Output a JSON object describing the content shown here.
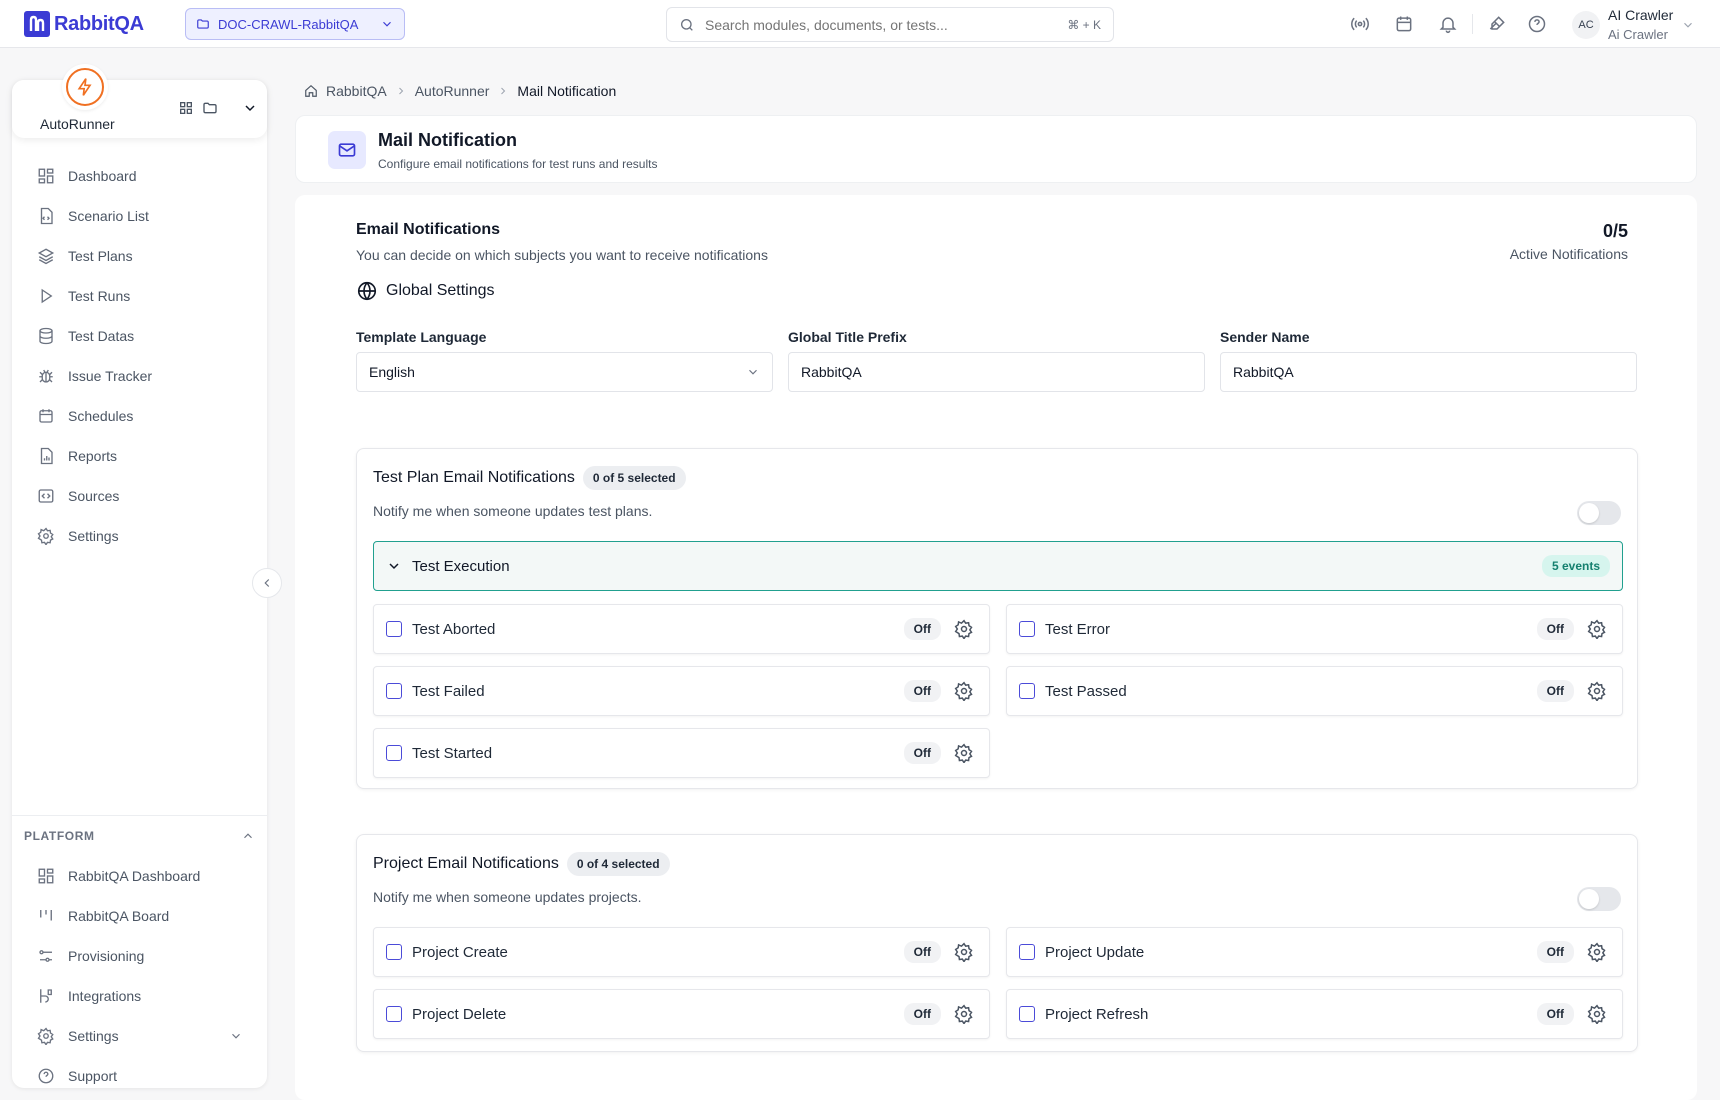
{
  "app": {
    "name": "RabbitQA",
    "project": "DOC-CRAWL-RabbitQA"
  },
  "search": {
    "placeholder": "Search modules, documents, or tests...",
    "shortcut": "⌘ + K"
  },
  "top_icons": [
    "broadcast-icon",
    "calendar-icon",
    "bell-icon",
    "palette-icon",
    "help-icon"
  ],
  "user": {
    "initials": "AC",
    "name": "AI Crawler",
    "subtitle": "Ai Crawler"
  },
  "module": {
    "name": "AutoRunner",
    "accent": "#f07022"
  },
  "sidebar": {
    "items": [
      {
        "label": "Dashboard",
        "icon": "dashboard-icon"
      },
      {
        "label": "Scenario List",
        "icon": "file-code-icon"
      },
      {
        "label": "Test Plans",
        "icon": "layers-icon"
      },
      {
        "label": "Test Runs",
        "icon": "play-icon"
      },
      {
        "label": "Test Datas",
        "icon": "database-icon"
      },
      {
        "label": "Issue Tracker",
        "icon": "bug-icon"
      },
      {
        "label": "Schedules",
        "icon": "calendar-icon"
      },
      {
        "label": "Reports",
        "icon": "report-icon"
      },
      {
        "label": "Sources",
        "icon": "code-icon"
      },
      {
        "label": "Settings",
        "icon": "gear-icon"
      }
    ],
    "platform_header": "PLATFORM",
    "platform_items": [
      {
        "label": "RabbitQA Dashboard",
        "icon": "dashboard-icon"
      },
      {
        "label": "RabbitQA Board",
        "icon": "board-icon"
      },
      {
        "label": "Provisioning",
        "icon": "sliders-icon"
      },
      {
        "label": "Integrations",
        "icon": "integration-icon"
      },
      {
        "label": "Settings",
        "icon": "gear-icon"
      },
      {
        "label": "Support",
        "icon": "help-icon"
      }
    ]
  },
  "breadcrumb": {
    "home": "RabbitQA",
    "module": "AutoRunner",
    "current": "Mail Notification"
  },
  "page": {
    "title": "Mail Notification",
    "subtitle": "Configure email notifications for test runs and results"
  },
  "email": {
    "title": "Email Notifications",
    "subtitle": "You can decide on which subjects you want to receive notifications",
    "active_count": "0/5",
    "active_label": "Active Notifications"
  },
  "global_settings": {
    "title": "Global Settings",
    "template_language_label": "Template Language",
    "template_language_value": "English",
    "title_prefix_label": "Global Title Prefix",
    "title_prefix_value": "RabbitQA",
    "sender_name_label": "Sender Name",
    "sender_name_value": "RabbitQA"
  },
  "test_plan_section": {
    "title": "Test Plan Email Notifications",
    "selected": "0 of 5 selected",
    "description": "Notify me when someone updates test plans.",
    "enabled": false,
    "group": {
      "label": "Test Execution",
      "events": "5 events"
    },
    "items": [
      {
        "label": "Test Aborted",
        "status": "Off"
      },
      {
        "label": "Test Error",
        "status": "Off"
      },
      {
        "label": "Test Failed",
        "status": "Off"
      },
      {
        "label": "Test Passed",
        "status": "Off"
      },
      {
        "label": "Test Started",
        "status": "Off"
      }
    ]
  },
  "project_section": {
    "title": "Project Email Notifications",
    "selected": "0 of 4 selected",
    "description": "Notify me when someone updates projects.",
    "enabled": false,
    "items": [
      {
        "label": "Project Create",
        "status": "Off"
      },
      {
        "label": "Project Update",
        "status": "Off"
      },
      {
        "label": "Project Delete",
        "status": "Off"
      },
      {
        "label": "Project Refresh",
        "status": "Off"
      }
    ]
  },
  "colors": {
    "brand": "#3b3bd4",
    "teal": "#21a08f",
    "orange": "#f07022"
  }
}
